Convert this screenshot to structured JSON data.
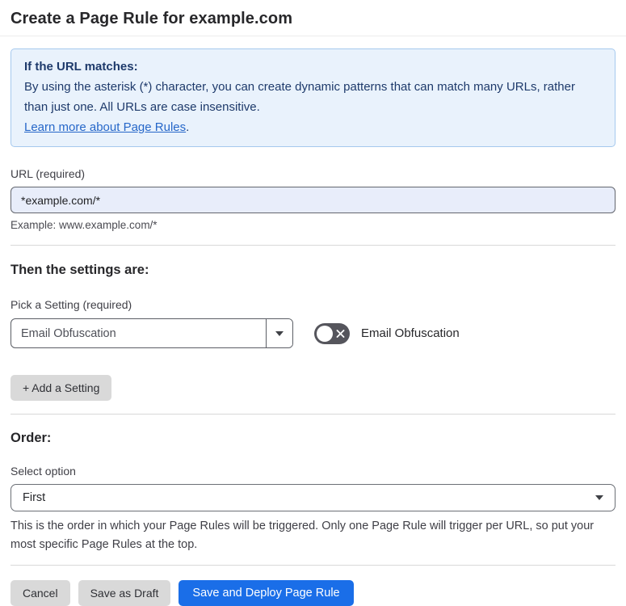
{
  "page": {
    "title": "Create a Page Rule for example.com"
  },
  "info_box": {
    "heading": "If the URL matches:",
    "body": "By using the asterisk (*) character, you can create dynamic patterns that can match many URLs, rather than just one. All URLs are case insensitive.",
    "link": "Learn more about Page Rules",
    "link_suffix": "."
  },
  "url_field": {
    "label": "URL (required)",
    "value": "*example.com/*",
    "helper": "Example: www.example.com/*"
  },
  "settings": {
    "heading": "Then the settings are:",
    "pick_label": "Pick a Setting (required)",
    "selected_setting": "Email Obfuscation",
    "toggle_label": "Email Obfuscation",
    "toggle_state": "off",
    "add_button": "+ Add a Setting"
  },
  "order": {
    "heading": "Order:",
    "label": "Select option",
    "selected_option": "First",
    "helper": "This is the order in which your Page Rules will be triggered. Only one Page Rule will trigger per URL, so put your most specific Page Rules at the top."
  },
  "footer": {
    "cancel": "Cancel",
    "save_draft": "Save as Draft",
    "save_deploy": "Save and Deploy Page Rule"
  },
  "colors": {
    "accent_blue": "#1a6ee8",
    "info_background": "#e9f2fc",
    "info_border": "#a6c9ee",
    "info_text": "#1e3a6b",
    "link_blue": "#2667c9",
    "url_input_background": "#e8edfa",
    "toggle_off_track": "#55555c",
    "gray_button": "#d9d9d9"
  }
}
